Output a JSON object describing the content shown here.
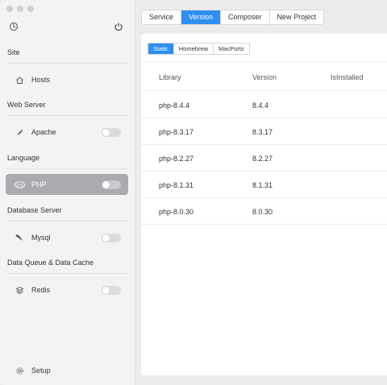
{
  "sidebar": {
    "groups": [
      {
        "title": "Site",
        "item": {
          "label": "Hosts",
          "icon": "home-icon",
          "toggle": false
        }
      },
      {
        "title": "Web Server",
        "item": {
          "label": "Apache",
          "icon": "feather-icon",
          "toggle": true
        }
      },
      {
        "title": "Language",
        "item": {
          "label": "PHP",
          "icon": "php-icon",
          "toggle": true,
          "active": true
        }
      },
      {
        "title": "Database Server",
        "item": {
          "label": "Mysql",
          "icon": "dolphin-icon",
          "toggle": true
        }
      },
      {
        "title": "Data Queue & Data Cache",
        "item": {
          "label": "Redis",
          "icon": "stack-icon",
          "toggle": true
        }
      }
    ],
    "setup_label": "Setup"
  },
  "tabs": [
    "Service",
    "Version",
    "Composer",
    "New Project"
  ],
  "active_tab": "Version",
  "subtabs": [
    "Static",
    "Homebrew",
    "MacPorts"
  ],
  "active_subtab": "Static",
  "table": {
    "headers": [
      "Library",
      "Version",
      "IsInstalled"
    ],
    "rows": [
      {
        "library": "php-8.4.4",
        "version": "8.4.4",
        "installed": ""
      },
      {
        "library": "php-8.3.17",
        "version": "8.3.17",
        "installed": ""
      },
      {
        "library": "php-8.2.27",
        "version": "8.2.27",
        "installed": ""
      },
      {
        "library": "php-8.1.31",
        "version": "8.1.31",
        "installed": ""
      },
      {
        "library": "php-8.0.30",
        "version": "8.0.30",
        "installed": ""
      }
    ]
  },
  "colors": {
    "accent": "#2f8ef0",
    "active_item": "#a9abae",
    "sidebar": "#f3f3f3",
    "background": "#ececec"
  }
}
